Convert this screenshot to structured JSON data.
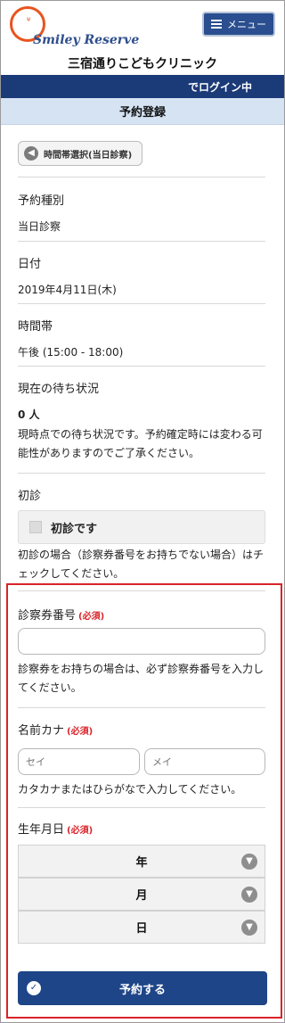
{
  "header": {
    "logo_text": "Smiley Reserve",
    "menu_label": "メニュー",
    "clinic_name": "三宿通りこどもクリニック"
  },
  "login_status": "でログイン中",
  "page_title": "予約登録",
  "time_select_button": "時間帯選択(当日診察)",
  "reservation_type": {
    "label": "予約種別",
    "value": "当日診察"
  },
  "date": {
    "label": "日付",
    "value": "2019年4月11日(木)"
  },
  "time_slot": {
    "label": "時間帯",
    "value": "午後 (15:00 - 18:00)"
  },
  "waiting": {
    "label": "現在の待ち状況",
    "count": "0 人",
    "note": "現時点での待ち状況です。予約確定時には変わる可能性がありますのでご了承ください。"
  },
  "first_visit": {
    "label": "初診",
    "checkbox_label": "初診です",
    "checked": false,
    "note": "初診の場合（診察券番号をお持ちでない場合）はチェックしてください。"
  },
  "required_tag": "(必須)",
  "card_number": {
    "label": "診察券番号",
    "value": "",
    "note": "診察券をお持ちの場合は、必ず診察券番号を入力してください。"
  },
  "name_kana": {
    "label": "名前カナ",
    "sei_placeholder": "セイ",
    "mei_placeholder": "メイ",
    "note": "カタカナまたはひらがなで入力してください。"
  },
  "birthdate": {
    "label": "生年月日",
    "year": "年",
    "month": "月",
    "day": "日"
  },
  "submit_label": "予約する",
  "colors": {
    "navy": "#1b3a78",
    "title_bg": "#d5e3f3",
    "accent_red": "#d9232a",
    "logo_orange": "#e8541f"
  }
}
